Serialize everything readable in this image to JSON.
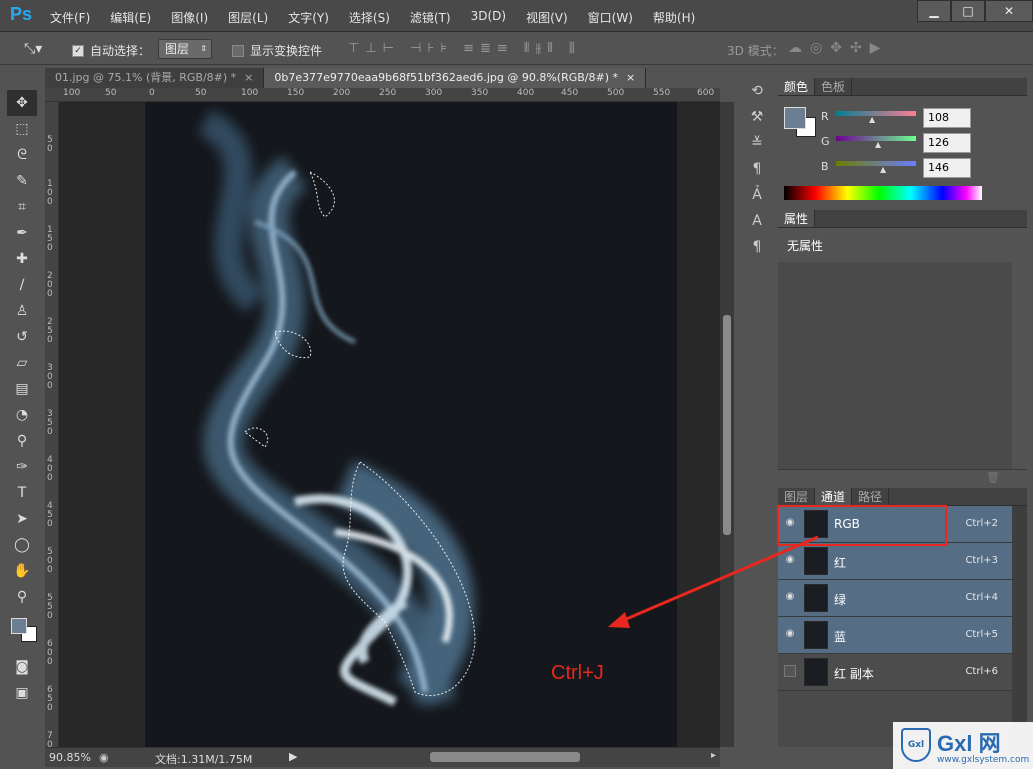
{
  "app": {
    "logo": "Ps",
    "menus": [
      "文件(F)",
      "编辑(E)",
      "图像(I)",
      "图层(L)",
      "文字(Y)",
      "选择(S)",
      "滤镜(T)",
      "3D(D)",
      "视图(V)",
      "窗口(W)",
      "帮助(H)"
    ],
    "window_buttons": {
      "minimize": "▁",
      "restore": "□",
      "close": "✕"
    }
  },
  "options": {
    "auto_select_label": "自动选择：",
    "layer_dropdown": "图层",
    "show_transform_label": "显示变换控件",
    "mode_3d_label": "3D 模式："
  },
  "tabs": [
    {
      "label": "01.jpg @ 75.1% (背景, RGB/8#) *",
      "close": "×"
    },
    {
      "label": "0b7e377e9770eaa9b68f51bf362aed6.jpg @ 90.8%(RGB/8#) *",
      "close": "×"
    }
  ],
  "ruler": {
    "h": [
      "100",
      "50",
      "0",
      "50",
      "100",
      "150",
      "200",
      "250",
      "300",
      "350",
      "400",
      "450",
      "500",
      "550",
      "600"
    ],
    "v": [
      "50",
      "100",
      "150",
      "200",
      "250",
      "300",
      "350",
      "400",
      "450",
      "500",
      "550",
      "600",
      "650",
      "700"
    ]
  },
  "status": {
    "zoom": "90.85%",
    "doc": "文档:1.31M/1.75M"
  },
  "annotation": {
    "text": "Ctrl+J",
    "color": "#e8281e"
  },
  "color_panel": {
    "tabs": [
      "颜色",
      "色板"
    ],
    "channels": [
      {
        "label": "R",
        "value": "108"
      },
      {
        "label": "G",
        "value": "126"
      },
      {
        "label": "B",
        "value": "146"
      }
    ],
    "fg_color": "#6c7e92"
  },
  "properties_panel": {
    "tab": "属性",
    "text": "无属性"
  },
  "channels_panel": {
    "tabs": [
      "图层",
      "通道",
      "路径"
    ],
    "rows": [
      {
        "name": "RGB",
        "shortcut": "Ctrl+2",
        "visible": true
      },
      {
        "name": "红",
        "shortcut": "Ctrl+3",
        "visible": true
      },
      {
        "name": "绿",
        "shortcut": "Ctrl+4",
        "visible": true
      },
      {
        "name": "蓝",
        "shortcut": "Ctrl+5",
        "visible": true
      },
      {
        "name": "红 副本",
        "shortcut": "Ctrl+6",
        "visible": false
      }
    ]
  },
  "watermark": {
    "brand": "Gxl 网",
    "url": "www.gxlsystem.com"
  }
}
